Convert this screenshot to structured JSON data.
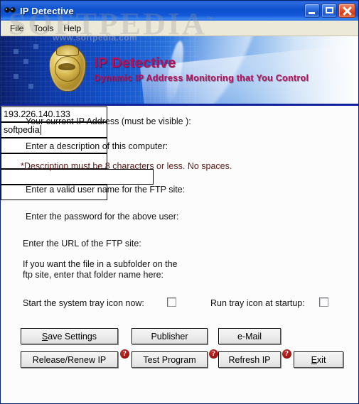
{
  "window": {
    "title": "IP Detective",
    "icon": "detective-glasses-icon",
    "controls": {
      "minimize": "Minimize",
      "maximize": "Maximize",
      "close": "Close"
    }
  },
  "menubar": {
    "items": [
      {
        "label": "File"
      },
      {
        "label": "Tools"
      },
      {
        "label": "Help"
      }
    ]
  },
  "banner": {
    "badge_icon": "detective-badge-icon",
    "title": "IP Detective",
    "subtitle": "Dynamic IP Address Monitoring that You Control",
    "title_color": "#b3125c",
    "background_color": "#0d3aa8"
  },
  "watermark": {
    "brand": "SOFTPEDIA",
    "trademark": "™",
    "url": "www.softpedia.com"
  },
  "form": {
    "ip_address": {
      "label": "Your current IP Address (must be visible ):",
      "value": "193.226.140.133",
      "placeholder": ""
    },
    "description": {
      "label": "Enter a description of this computer:",
      "value": "softpedia",
      "placeholder": ""
    },
    "description_note": "*Description must be 8 characters or less. No spaces.",
    "username": {
      "label": "Enter a valid user name for the FTP site:",
      "value": "",
      "placeholder": ""
    },
    "password": {
      "label": "Enter the password for the above user:",
      "value": "",
      "placeholder": ""
    },
    "ftp_url": {
      "label": "Enter the URL of the FTP site:",
      "value": "",
      "placeholder": ""
    },
    "subfolder": {
      "label_line1": "If you want the file in a subfolder on the",
      "label_line2": "ftp site, enter that folder name here:",
      "value": "",
      "placeholder": ""
    },
    "tray_now": {
      "label": "Start the system tray icon now:",
      "checked": false
    },
    "tray_startup": {
      "label": "Run tray icon at startup:",
      "checked": false
    }
  },
  "buttons": {
    "save_settings": {
      "label": "Save Settings",
      "accel": "S"
    },
    "publisher": {
      "label": "Publisher"
    },
    "email": {
      "label": "e-Mail"
    },
    "release_renew": {
      "label": "Release/Renew IP"
    },
    "test_program": {
      "label": "Test Program"
    },
    "refresh_ip": {
      "label": "Refresh IP"
    },
    "exit": {
      "label": "Exit",
      "accel": "E"
    },
    "help_glyph": "?"
  }
}
